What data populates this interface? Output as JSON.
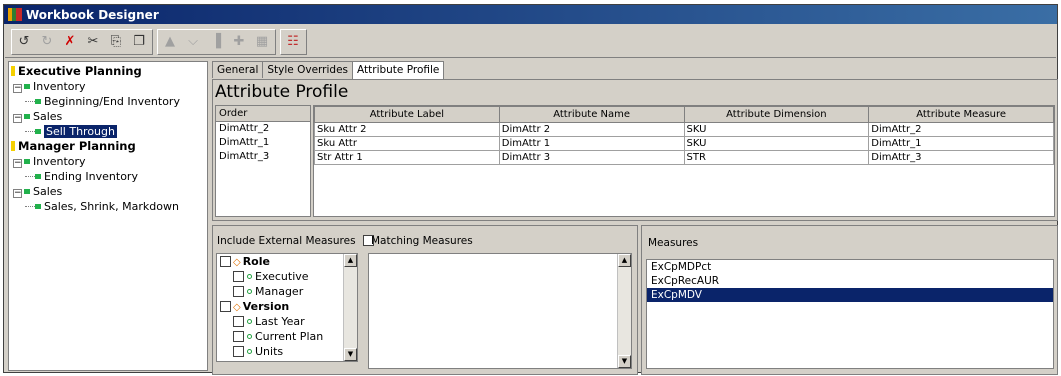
{
  "window": {
    "title": "Workbook Designer"
  },
  "toolbar": {
    "buttons": [
      "undo-icon",
      "redo-icon",
      "delete-icon",
      "cut-icon",
      "copy-icon",
      "paste-icon",
      "move-up-icon",
      "chevron-down-icon",
      "bars-icon",
      "add-icon",
      "grid-icon",
      "chart-icon"
    ]
  },
  "tree": {
    "nodes": [
      {
        "label": "Executive Planning",
        "level": 0,
        "bold": true
      },
      {
        "label": "Inventory",
        "level": 1
      },
      {
        "label": "Beginning/End Inventory",
        "level": 2
      },
      {
        "label": "Sales",
        "level": 1
      },
      {
        "label": "Sell Through",
        "level": 2,
        "selected": true
      },
      {
        "label": "Manager Planning",
        "level": 0,
        "bold": true
      },
      {
        "label": "Inventory",
        "level": 1
      },
      {
        "label": "Ending Inventory",
        "level": 2
      },
      {
        "label": "Sales",
        "level": 1
      },
      {
        "label": "Sales, Shrink, Markdown",
        "level": 2
      }
    ]
  },
  "tabs": [
    "General",
    "Style Overrides",
    "Attribute Profile"
  ],
  "page_title": "Attribute Profile",
  "order": {
    "header": "Order",
    "items": [
      "DimAttr_2",
      "DimAttr_1",
      "DimAttr_3"
    ]
  },
  "attr_table": {
    "headers": [
      "Attribute Label",
      "Attribute Name",
      "Attribute Dimension",
      "Attribute Measure"
    ],
    "rows": [
      [
        "Sku Attr 2",
        "DimAttr 2",
        "SKU",
        "DimAttr_2"
      ],
      [
        "Sku Attr",
        "DimAttr 1",
        "SKU",
        "DimAttr_1"
      ],
      [
        "Str Attr 1",
        "DimAttr 3",
        "STR",
        "DimAttr_3"
      ]
    ]
  },
  "bottom_left": {
    "include_external_label": "Include External Measures",
    "matching_label": "Matching Measures",
    "dims": [
      {
        "label": "Role",
        "bold": true
      },
      {
        "label": "Executive"
      },
      {
        "label": "Manager"
      },
      {
        "label": "Version",
        "bold": true
      },
      {
        "label": "Last Year"
      },
      {
        "label": "Current Plan"
      },
      {
        "label": "Units"
      }
    ]
  },
  "measures": {
    "label": "Measures",
    "items": [
      "ExCpMDPct",
      "ExCpRecAUR",
      "ExCpMDV"
    ],
    "selected": "ExCpMDV"
  },
  "colors": {
    "title_bar": "#0a246a",
    "selection": "#0a246a",
    "leaf": "#22b14c"
  }
}
